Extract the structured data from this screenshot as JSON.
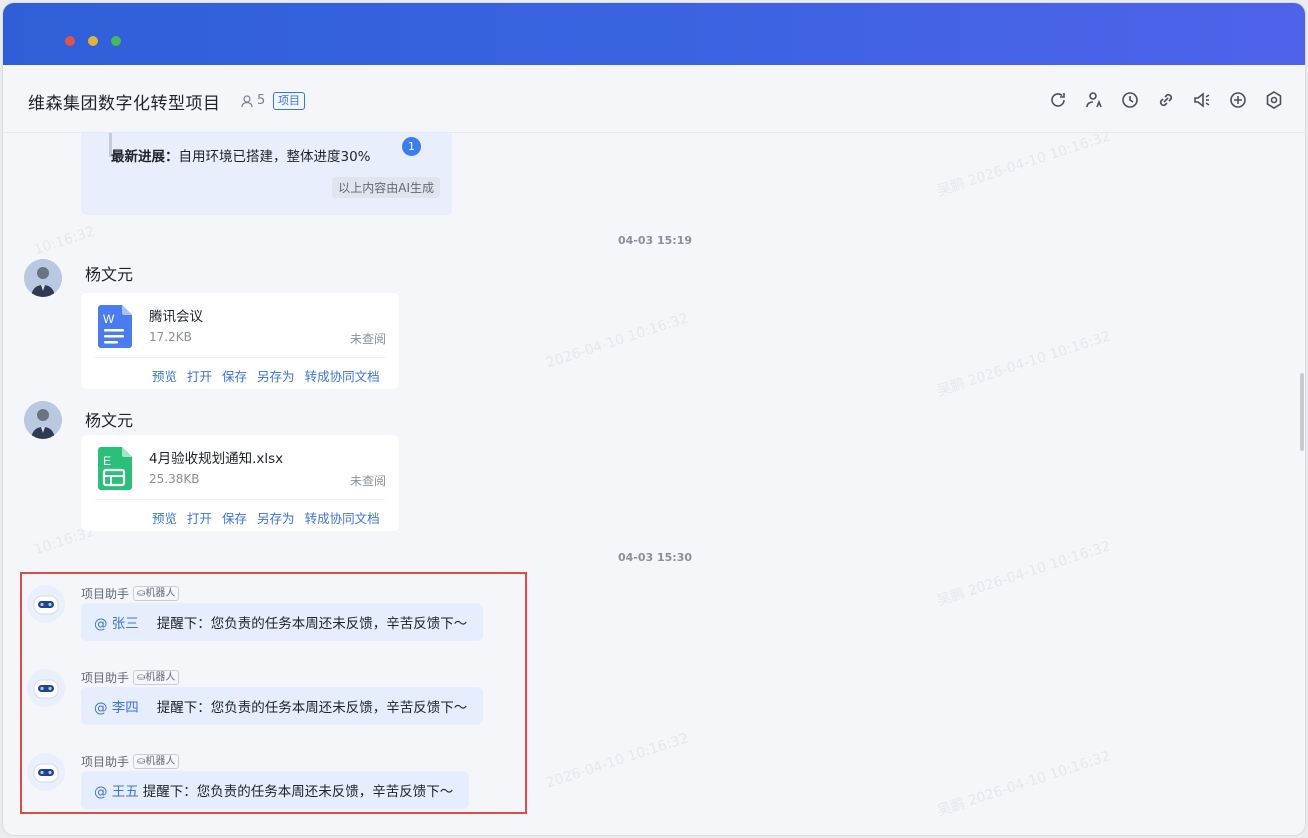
{
  "header": {
    "title": "维森集团数字化转型项目",
    "member_count": "5",
    "tag": "项目"
  },
  "ai_summary": {
    "label": "最新进展：",
    "text": "自用环境已搭建，整体进度30%",
    "badge": "1",
    "footer": "以上内容由AI生成"
  },
  "messages": {
    "time1": "04-03 15:19",
    "time2": "04-03 15:30",
    "file1": {
      "sender": "杨文元",
      "name": "腾讯会议",
      "size": "17.2KB",
      "status": "未查阅",
      "icon_letter": "W",
      "color": "#4a7cf0"
    },
    "file2": {
      "sender": "杨文元",
      "name": "4月验收规划通知.xlsx",
      "size": "25.38KB",
      "status": "未查阅",
      "icon_letter": "E",
      "color": "#2bc07a"
    },
    "actions": [
      "预览",
      "打开",
      "保存",
      "另存为",
      "转成协同文档"
    ],
    "bot": {
      "name": "项目助手",
      "tag": "机器人",
      "items": [
        {
          "mention": "@ 张三",
          "text": "提醒下：您负责的任务本周还未反馈，辛苦反馈下～"
        },
        {
          "mention": "@ 李四",
          "text": "提醒下：您负责的任务本周还未反馈，辛苦反馈下～"
        },
        {
          "mention": "@ 王五",
          "text": "提醒下：您负责的任务本周还未反馈，辛苦反馈下～"
        }
      ]
    }
  },
  "colors": {
    "accent": "#3b73e8",
    "highlight": "#e24a4a"
  }
}
